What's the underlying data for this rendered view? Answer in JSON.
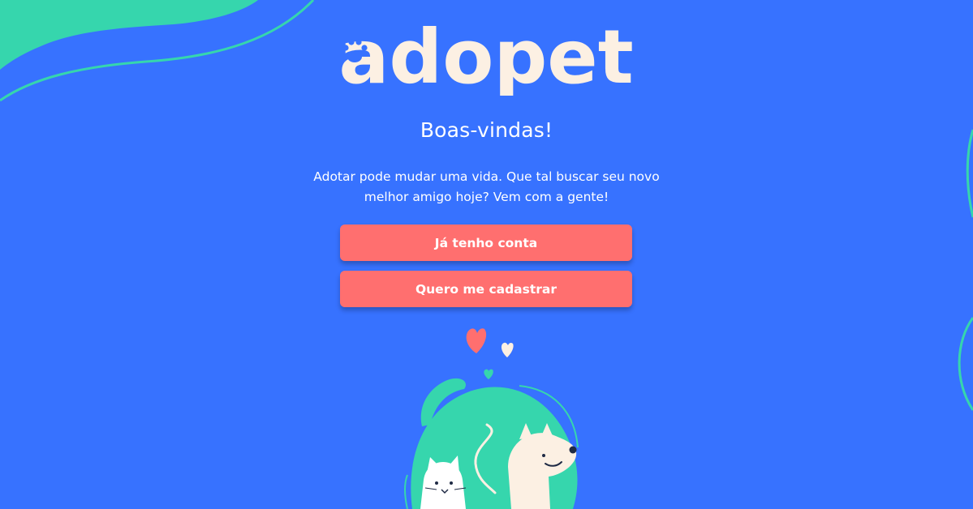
{
  "brand": {
    "name": "adopet"
  },
  "welcome": {
    "title": "Boas-vindas!",
    "message": "Adotar pode mudar uma vida. Que tal buscar seu novo melhor amigo hoje? Vem com a gente!"
  },
  "actions": {
    "login_label": "Já tenho conta",
    "register_label": "Quero me cadastrar"
  },
  "colors": {
    "background": "#3772FF",
    "accent_green": "#36D6AD",
    "button": "#FF6F6F",
    "logo": "#FCF0E3"
  }
}
